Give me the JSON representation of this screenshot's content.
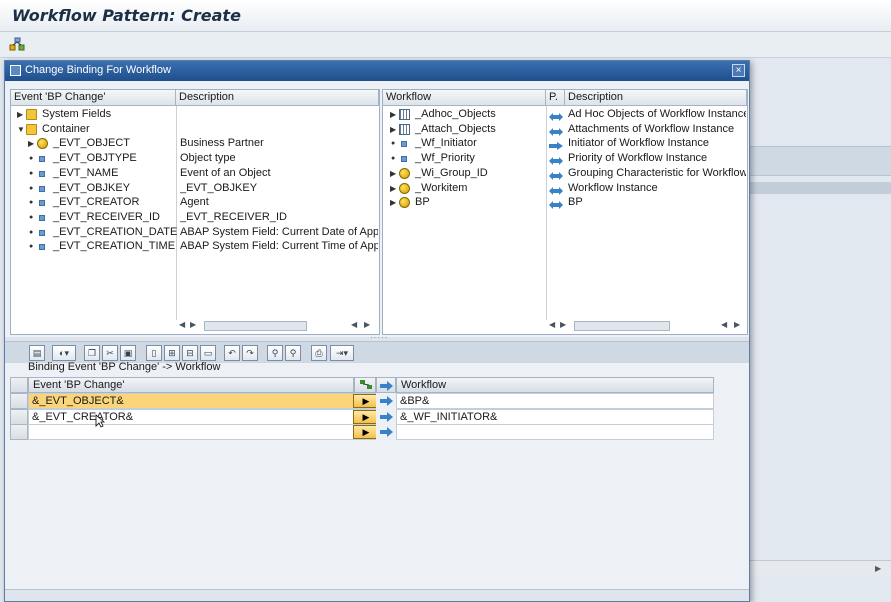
{
  "app": {
    "title": "Workflow Pattern: Create"
  },
  "dialog": {
    "title": "Change Binding For Workflow",
    "close_label": "×"
  },
  "left_tree": {
    "headers": [
      "Event 'BP Change'",
      "Description"
    ],
    "rows": [
      {
        "name": "System Fields",
        "desc": "",
        "icon": "folder-icon",
        "level": 0,
        "expander": "collapsed"
      },
      {
        "name": "Container",
        "desc": "",
        "icon": "folder-open-icon",
        "level": 0,
        "expander": "expanded"
      },
      {
        "name": "_EVT_OBJECT",
        "desc": "Business Partner",
        "icon": "object-icon",
        "level": 1,
        "expander": "collapsed"
      },
      {
        "name": "_EVT_OBJTYPE",
        "desc": "Object type",
        "icon": "element-icon",
        "level": 1,
        "expander": "none"
      },
      {
        "name": "_EVT_NAME",
        "desc": "Event of an Object",
        "icon": "element-icon",
        "level": 1,
        "expander": "none"
      },
      {
        "name": "_EVT_OBJKEY",
        "desc": "_EVT_OBJKEY",
        "icon": "element-icon",
        "level": 1,
        "expander": "none"
      },
      {
        "name": "_EVT_CREATOR",
        "desc": "Agent",
        "icon": "element-icon",
        "level": 1,
        "expander": "none"
      },
      {
        "name": "_EVT_RECEIVER_ID",
        "desc": "_EVT_RECEIVER_ID",
        "icon": "element-icon",
        "level": 1,
        "expander": "none"
      },
      {
        "name": "_EVT_CREATION_DATE",
        "desc": "ABAP System Field: Current Date of Application Server",
        "icon": "element-icon",
        "level": 1,
        "expander": "none"
      },
      {
        "name": "_EVT_CREATION_TIME",
        "desc": "ABAP System Field: Current Time of Application Server",
        "icon": "element-icon",
        "level": 1,
        "expander": "none"
      }
    ]
  },
  "right_tree": {
    "headers": [
      "Workflow",
      "P.",
      "Description"
    ],
    "rows": [
      {
        "name": "_Adhoc_Objects",
        "desc": "Ad Hoc Objects of Workflow Instance",
        "icon": "table-icon",
        "expander": "collapsed",
        "binding": "both"
      },
      {
        "name": "_Attach_Objects",
        "desc": "Attachments of Workflow Instance",
        "icon": "table-icon",
        "expander": "collapsed",
        "binding": "both"
      },
      {
        "name": "_Wf_Initiator",
        "desc": "Initiator of Workflow Instance",
        "icon": "element-icon",
        "expander": "none",
        "binding": "import"
      },
      {
        "name": "_Wf_Priority",
        "desc": "Priority of Workflow Instance",
        "icon": "element-icon",
        "expander": "none",
        "binding": "both"
      },
      {
        "name": "_Wi_Group_ID",
        "desc": "Grouping Characteristic for Workflow Instances",
        "icon": "object-icon",
        "expander": "collapsed",
        "binding": "both"
      },
      {
        "name": "_Workitem",
        "desc": "Workflow Instance",
        "icon": "object-icon",
        "expander": "collapsed",
        "binding": "both"
      },
      {
        "name": "BP",
        "desc": "BP",
        "icon": "object-icon",
        "expander": "collapsed",
        "binding": "both"
      }
    ]
  },
  "binding": {
    "title": "Binding Event 'BP Change' -> Workflow",
    "source_header": "Event 'BP Change'",
    "target_header": "Workflow",
    "direction_label": "▶",
    "rows": [
      {
        "source": "&_EVT_OBJECT&",
        "target": "&BP&",
        "selected": true
      },
      {
        "source": "&_EVT_CREATOR&",
        "target": "&_WF_INITIATOR&",
        "selected": false
      },
      {
        "source": "",
        "target": "",
        "selected": false
      }
    ]
  },
  "toolbar_icons": [
    "binding-new-icon",
    "drag-icon",
    "copy-icon",
    "cut-icon",
    "paste-icon",
    "new-row-icon",
    "insert-row-icon",
    "delete-row-icon",
    "clear-icon",
    "undo-icon",
    "redo-icon",
    "find-icon",
    "find-next-icon",
    "print-icon",
    "export-icon"
  ]
}
